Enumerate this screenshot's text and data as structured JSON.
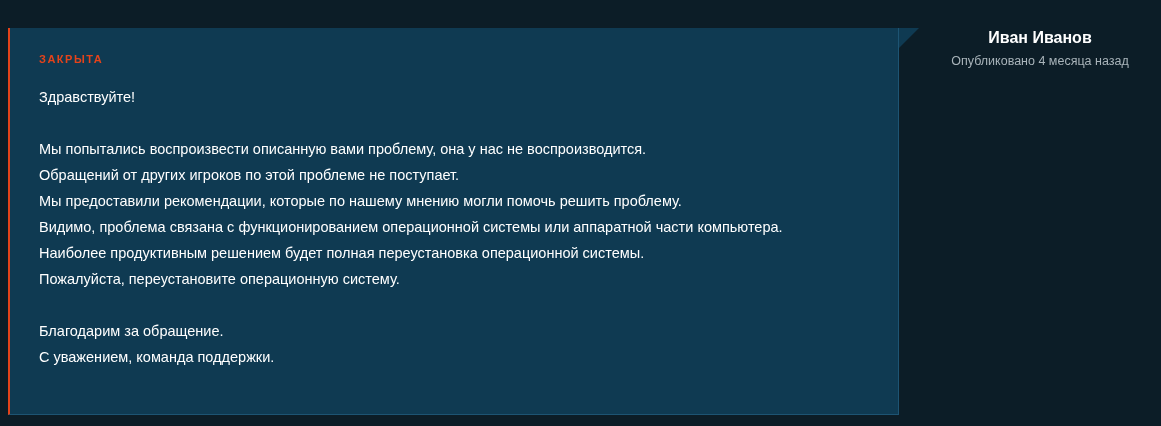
{
  "message": {
    "status": "ЗАКРЫТА",
    "paragraphs": [
      [
        "Здравствуйте!"
      ],
      [
        "Мы попытались воспроизвести описанную вами проблему, она у нас не воспроизводится.",
        "Обращений от других игроков по этой проблеме не поступает.",
        "Мы предоставили рекомендации, которые по нашему мнению могли помочь решить проблему.",
        "Видимо, проблема связана с функционированием операционной системы или аппаратной части компьютера.",
        "Наиболее продуктивным решением будет полная переустановка операционной системы.",
        "Пожалуйста, переустановите операционную систему."
      ],
      [
        "Благодарим за обращение.",
        "С уважением, команда поддержки."
      ]
    ]
  },
  "author": {
    "name": "Иван Иванов",
    "published": "Опубликовано 4 месяца назад"
  }
}
